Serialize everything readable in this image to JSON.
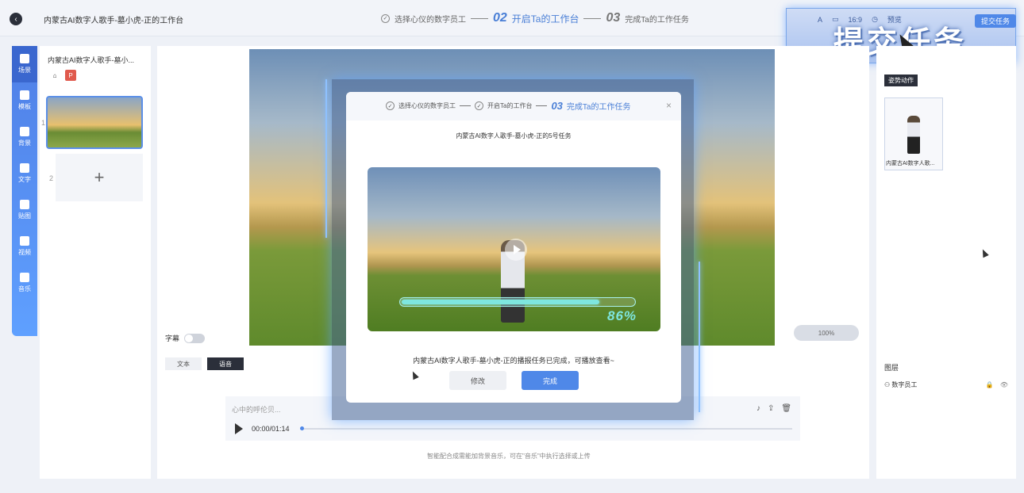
{
  "header": {
    "title": "内蒙古AI数字人歌手-墓小虎-正的工作台",
    "steps": [
      {
        "label": "选择心仪的数字员工",
        "num": ""
      },
      {
        "label": "开启Ta的工作台",
        "num": "02"
      },
      {
        "label": "完成Ta的工作任务",
        "num": "03"
      }
    ],
    "toolbar": [
      "16:9",
      "预览"
    ],
    "submit_small": "提交任务",
    "submit_big": "提交任务"
  },
  "rail": [
    {
      "label": "场景",
      "icon": "scene-icon"
    },
    {
      "label": "模板",
      "icon": "template-icon"
    },
    {
      "label": "背景",
      "icon": "background-icon"
    },
    {
      "label": "文字",
      "icon": "text-icon"
    },
    {
      "label": "贴图",
      "icon": "sticker-icon"
    },
    {
      "label": "视频",
      "icon": "video-icon"
    },
    {
      "label": "音乐",
      "icon": "music-icon"
    }
  ],
  "scenes": {
    "title": "内蒙古AI数字人歌手-墓小...",
    "badge": "P",
    "items": [
      {
        "num": "1"
      },
      {
        "num": "2",
        "add": "+"
      }
    ]
  },
  "canvas": {
    "subtitle_label": "字幕",
    "tab_text": "文本",
    "tab_voice": "语音",
    "zoom": "100%",
    "audio_placeholder": "心中的呼伦贝...",
    "time": "00:00/01:14",
    "hint": "智能配合成需能加背景音乐，可在\"音乐\"中执行选择或上传"
  },
  "right": {
    "action_tag": "姿势动作",
    "person_label": "内蒙古AI数字人歌...",
    "layers_title": "图层",
    "layer_item": "数字员工"
  },
  "modal": {
    "steps": [
      {
        "label": "选择心仪的数字员工",
        "num": ""
      },
      {
        "label": "开启Ta的工作台",
        "num": ""
      },
      {
        "label": "完成Ta的工作任务",
        "num": "03"
      }
    ],
    "close": "×",
    "task_title": "内蒙古AI数字人歌手-墓小虎-正的5号任务",
    "progress_percent": 86,
    "progress_text": "86%",
    "message": "内蒙古AI数字人歌手-墓小虎-正的播报任务已完成，可播放查看~",
    "edit_label": "修改",
    "done_label": "完成"
  }
}
